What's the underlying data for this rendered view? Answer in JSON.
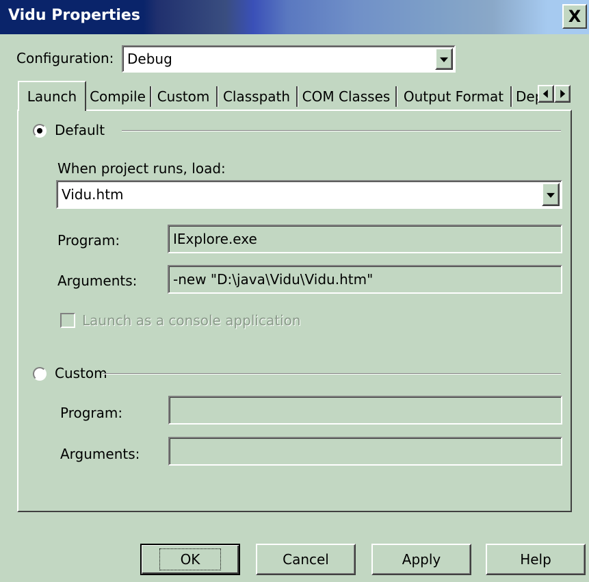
{
  "window": {
    "title": "Vidu Properties",
    "close_glyph": "X",
    "close_icon": "close-icon"
  },
  "configuration": {
    "label": "Configuration:",
    "value": "Debug"
  },
  "tabs": [
    {
      "label": "Launch",
      "selected": true
    },
    {
      "label": "Compile"
    },
    {
      "label": "Custom"
    },
    {
      "label": "Classpath"
    },
    {
      "label": "COM Classes"
    },
    {
      "label": "Output Format"
    },
    {
      "label": "Dep"
    }
  ],
  "launch": {
    "default_label": "Default",
    "default_selected": true,
    "when_runs_label": "When project runs, load:",
    "load_value": "Vidu.htm",
    "program_label": "Program:",
    "program_value": "IExplore.exe",
    "arguments_label": "Arguments:",
    "arguments_value": "-new \"D:\\java\\Vidu\\Vidu.htm\"",
    "console_label": "Launch as a console application",
    "console_checked": false,
    "custom_label": "Custom",
    "custom_selected": false,
    "custom_program_label": "Program:",
    "custom_program_value": "",
    "custom_arguments_label": "Arguments:",
    "custom_arguments_value": ""
  },
  "buttons": {
    "ok": "OK",
    "cancel": "Cancel",
    "apply": "Apply",
    "help": "Help"
  }
}
